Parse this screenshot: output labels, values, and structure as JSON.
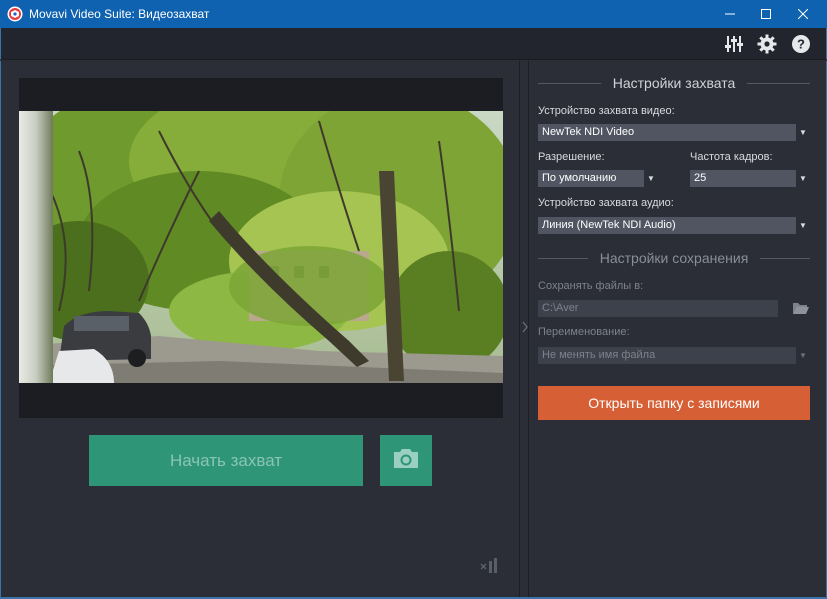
{
  "window": {
    "title": "Movavi Video Suite: Видеозахват",
    "controls": {
      "minimize": "—",
      "maximize": "☐",
      "close": "✕"
    }
  },
  "toolbar": {
    "icons": [
      "mixer-settings-icon",
      "gear-icon",
      "help-icon"
    ]
  },
  "preview": {
    "start_capture_label": "Начать захват",
    "snapshot_icon": "camera-icon",
    "audio_indicator_icon": "audio-level-icon"
  },
  "capture_settings": {
    "heading": "Настройки захвата",
    "video_device_label": "Устройство захвата видео:",
    "video_device_value": "NewTek NDI Video",
    "resolution_label": "Разрешение:",
    "resolution_value": "По умолчанию",
    "framerate_label": "Частота кадров:",
    "framerate_value": "25",
    "audio_device_label": "Устройство захвата аудио:",
    "audio_device_value": "Линия (NewTek NDI Audio)"
  },
  "save_settings": {
    "heading": "Настройки сохранения",
    "save_to_label": "Сохранять файлы в:",
    "save_to_value": "C:\\Aver",
    "rename_label": "Переименование:",
    "rename_value": "Не менять имя файла",
    "open_folder_label": "Открыть папку с записями"
  },
  "colors": {
    "titlebar": "#0f62b0",
    "background": "#2b2e37",
    "accent_green": "#2e9577",
    "accent_orange": "#d75f36"
  }
}
